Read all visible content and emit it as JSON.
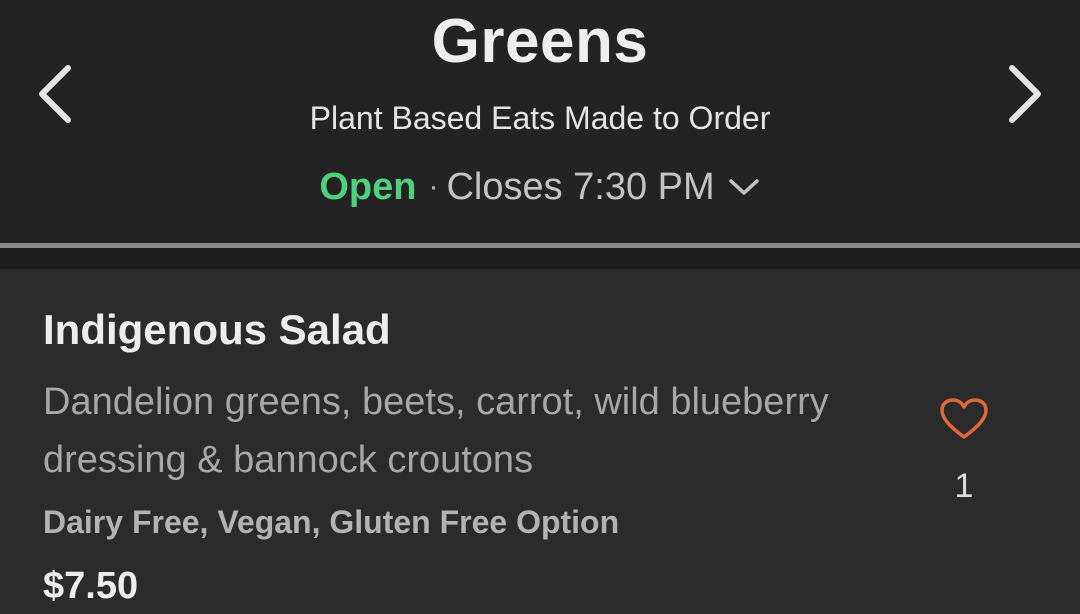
{
  "header": {
    "title": "Greens",
    "subtitle": "Plant Based Eats Made to Order",
    "status": {
      "open_label": "Open",
      "separator": "·",
      "closes_text": "Closes 7:30 PM"
    },
    "prev_icon": "chevron-left-icon",
    "next_icon": "chevron-right-icon",
    "hours_icon": "chevron-down-icon"
  },
  "menu_item": {
    "name": "Indigenous Salad",
    "description": "Dandelion greens, beets, carrot, wild blueberry dressing & bannock croutons",
    "tags": "Dairy Free, Vegan, Gluten Free Option",
    "price": "$7.50",
    "like_icon": "heart-outline-icon",
    "like_count": "1"
  },
  "colors": {
    "background": "#222222",
    "open_status": "#4ed07c",
    "heart": "#e0683a",
    "divider": "#8a8a8a"
  }
}
